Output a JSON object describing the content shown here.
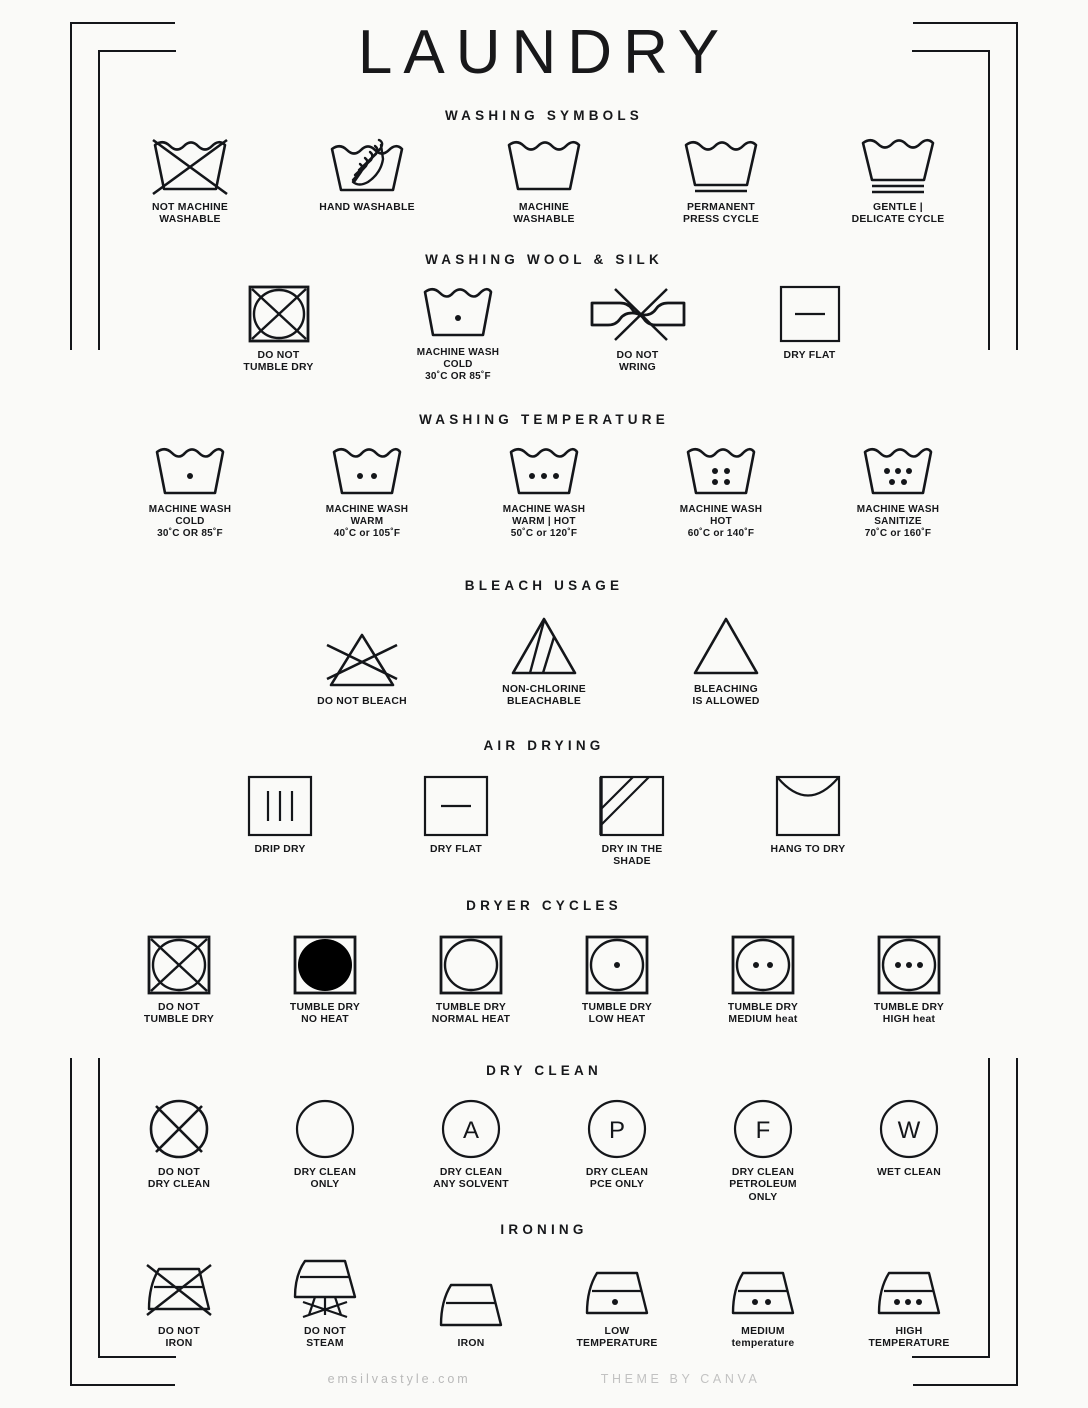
{
  "page": {
    "title": "LAUNDRY",
    "background_color": "#fafaf8",
    "ink_color": "#14161a"
  },
  "footer": {
    "left": "emsilvastyle.com",
    "right": "THEME BY CANVA"
  },
  "sections": [
    {
      "heading": "WASHING SYMBOLS",
      "items": [
        {
          "icon": "basin-crossed-icon",
          "label": "NOT MACHINE\nWASHABLE"
        },
        {
          "icon": "basin-hand-icon",
          "label": "HAND WASHABLE"
        },
        {
          "icon": "basin-icon",
          "label": "MACHINE\nWASHABLE"
        },
        {
          "icon": "basin-one-bar-icon",
          "label": "PERMANENT\nPRESS CYCLE"
        },
        {
          "icon": "basin-two-bar-icon",
          "label": "GENTLE |\nDELICATE CYCLE"
        }
      ]
    },
    {
      "heading": "WASHING WOOL & SILK",
      "items": [
        {
          "icon": "square-circle-cross-icon",
          "label": "DO NOT\nTUMBLE DRY"
        },
        {
          "icon": "basin-one-dot-icon",
          "label": "MACHINE WASH\nCOLD\n30˚C OR 85˚F"
        },
        {
          "icon": "wring-crossed-icon",
          "label": "DO NOT\nWRING"
        },
        {
          "icon": "square-bar-icon",
          "label": "DRY FLAT"
        }
      ]
    },
    {
      "heading": "WASHING TEMPERATURE",
      "items": [
        {
          "icon": "basin-one-dot-icon",
          "label": "MACHINE WASH\nCOLD\n30˚C OR 85˚F"
        },
        {
          "icon": "basin-two-dot-icon",
          "label": "MACHINE WASH\nWARM\n40˚C or 105˚F"
        },
        {
          "icon": "basin-three-dot-icon",
          "label": "MACHINE WASH\nWARM | HOT\n50˚C or 120˚F"
        },
        {
          "icon": "basin-four-dot-icon",
          "label": "MACHINE WASH\nHOT\n60˚C or 140˚F"
        },
        {
          "icon": "basin-five-dot-icon",
          "label": "MACHINE WASH\nSANITIZE\n70˚C or 160˚F"
        }
      ]
    },
    {
      "heading": "BLEACH USAGE",
      "items": [
        {
          "icon": "triangle-crossed-icon",
          "label": "DO NOT BLEACH"
        },
        {
          "icon": "triangle-striped-icon",
          "label": "NON-CHLORINE\nBLEACHABLE"
        },
        {
          "icon": "triangle-icon",
          "label": "BLEACHING\nIS ALLOWED"
        }
      ]
    },
    {
      "heading": "AIR DRYING",
      "items": [
        {
          "icon": "square-three-bars-icon",
          "label": "DRIP DRY"
        },
        {
          "icon": "square-bar-icon",
          "label": "DRY FLAT"
        },
        {
          "icon": "square-shade-icon",
          "label": "DRY IN THE\nSHADE"
        },
        {
          "icon": "square-arc-icon",
          "label": "HANG TO DRY"
        }
      ]
    },
    {
      "heading": "DRYER CYCLES",
      "items": [
        {
          "icon": "square-circle-cross-icon",
          "label": "DO NOT\nTUMBLE DRY"
        },
        {
          "icon": "square-circle-filled-icon",
          "label": "TUMBLE DRY\nNO HEAT"
        },
        {
          "icon": "square-circle-icon",
          "label": "TUMBLE DRY\nNORMAL HEAT"
        },
        {
          "icon": "square-circle-one-dot-icon",
          "label": "TUMBLE DRY\nLOW HEAT"
        },
        {
          "icon": "square-circle-two-dot-icon",
          "label": "TUMBLE DRY\nMEDIUM heat"
        },
        {
          "icon": "square-circle-three-dot-icon",
          "label": "TUMBLE DRY\nHIGH heat"
        }
      ]
    },
    {
      "heading": "DRY CLEAN",
      "items": [
        {
          "icon": "circle-crossed-icon",
          "label": "DO NOT\nDRY CLEAN"
        },
        {
          "icon": "circle-icon",
          "label": "DRY CLEAN\nONLY"
        },
        {
          "icon": "circle-a-icon",
          "letter": "A",
          "label": "DRY CLEAN\nANY SOLVENT"
        },
        {
          "icon": "circle-p-icon",
          "letter": "P",
          "label": "DRY CLEAN\nPCE ONLY"
        },
        {
          "icon": "circle-f-icon",
          "letter": "F",
          "label": "DRY CLEAN\nPETROLEUM\nONLY"
        },
        {
          "icon": "circle-w-icon",
          "letter": "W",
          "label": "WET CLEAN"
        }
      ]
    },
    {
      "heading": "IRONING",
      "items": [
        {
          "icon": "iron-crossed-icon",
          "label": "DO NOT\nIRON"
        },
        {
          "icon": "iron-no-steam-icon",
          "label": "DO NOT\nSTEAM"
        },
        {
          "icon": "iron-icon",
          "label": "IRON"
        },
        {
          "icon": "iron-one-dot-icon",
          "label": "LOW\nTEMPERATURE"
        },
        {
          "icon": "iron-two-dot-icon",
          "label": "MEDIUM\ntemperature"
        },
        {
          "icon": "iron-three-dot-icon",
          "label": "HIGH\nTEMPERATURE"
        }
      ]
    }
  ]
}
